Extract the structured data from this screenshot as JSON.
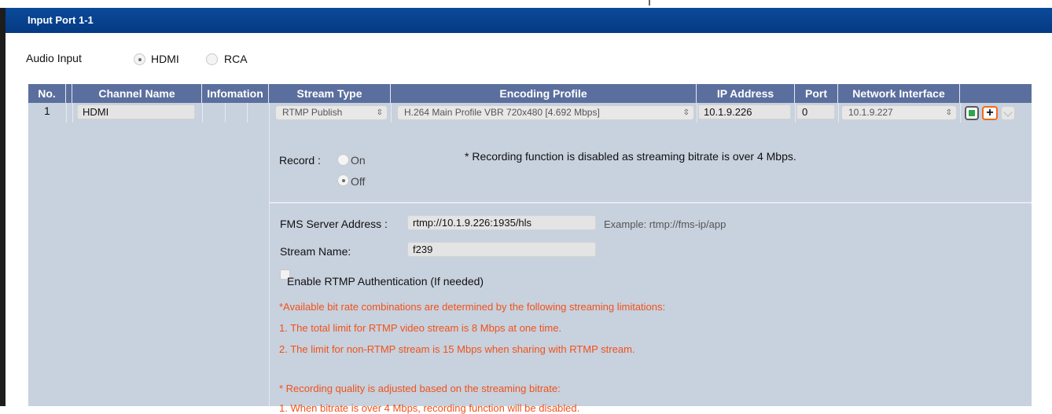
{
  "panel": {
    "title": "Input Port 1-1"
  },
  "audio_input": {
    "label": "Audio Input",
    "options": [
      {
        "label": "HDMI",
        "selected": true
      },
      {
        "label": "RCA",
        "selected": false
      }
    ]
  },
  "table": {
    "headers": [
      "No.",
      "Channel Name",
      "Infomation",
      "Stream Type",
      "Encoding Profile",
      "IP Address",
      "Port",
      "Network Interface"
    ],
    "row": {
      "no": "1",
      "channel_name": "HDMI",
      "stream_type": "RTMP Publish",
      "encoding_profile": "H.264 Main Profile VBR 720x480 [4.692 Mbps]",
      "ip_address": "10.1.9.226",
      "port": "0",
      "network_interface": "10.1.9.227"
    }
  },
  "record": {
    "label": "Record :",
    "on_label": "On",
    "off_label": "Off",
    "selected": "Off",
    "notice": "* Recording function is disabled as streaming bitrate is over 4 Mbps."
  },
  "fms": {
    "server_label": "FMS Server Address :",
    "server_value": "rtmp://10.1.9.226:1935/hls",
    "example": "Example: rtmp://fms-ip/app",
    "stream_label": "Stream Name:",
    "stream_value": "f239",
    "auth_label": "Enable RTMP Authentication (If needed)",
    "auth_checked": false
  },
  "notes": {
    "limits_heading": "*Available bit rate combinations are determined by the following streaming limitations:",
    "limit_1": "1. The total limit for RTMP video stream is 8 Mbps at one time.",
    "limit_2": "2. The limit for non-RTMP stream is 15 Mbps when sharing with RTMP stream.",
    "quality_heading": "* Recording quality is adjusted based on the streaming bitrate:",
    "quality_1": "1. When bitrate is over 4 Mbps, recording function will be disabled."
  },
  "colors": {
    "titlebar": "#0a4a9a",
    "table_header": "#5b6f9e",
    "table_body": "#c8d1de",
    "warning_text": "#f0521a",
    "add_button_border": "#f06a1a",
    "stop_button_fill": "#2aa84a"
  },
  "icons": {
    "stop": "stop-square-icon",
    "add": "plus-icon",
    "expand": "chevron-down-icon",
    "select_arrows": "updown-arrows-icon"
  }
}
